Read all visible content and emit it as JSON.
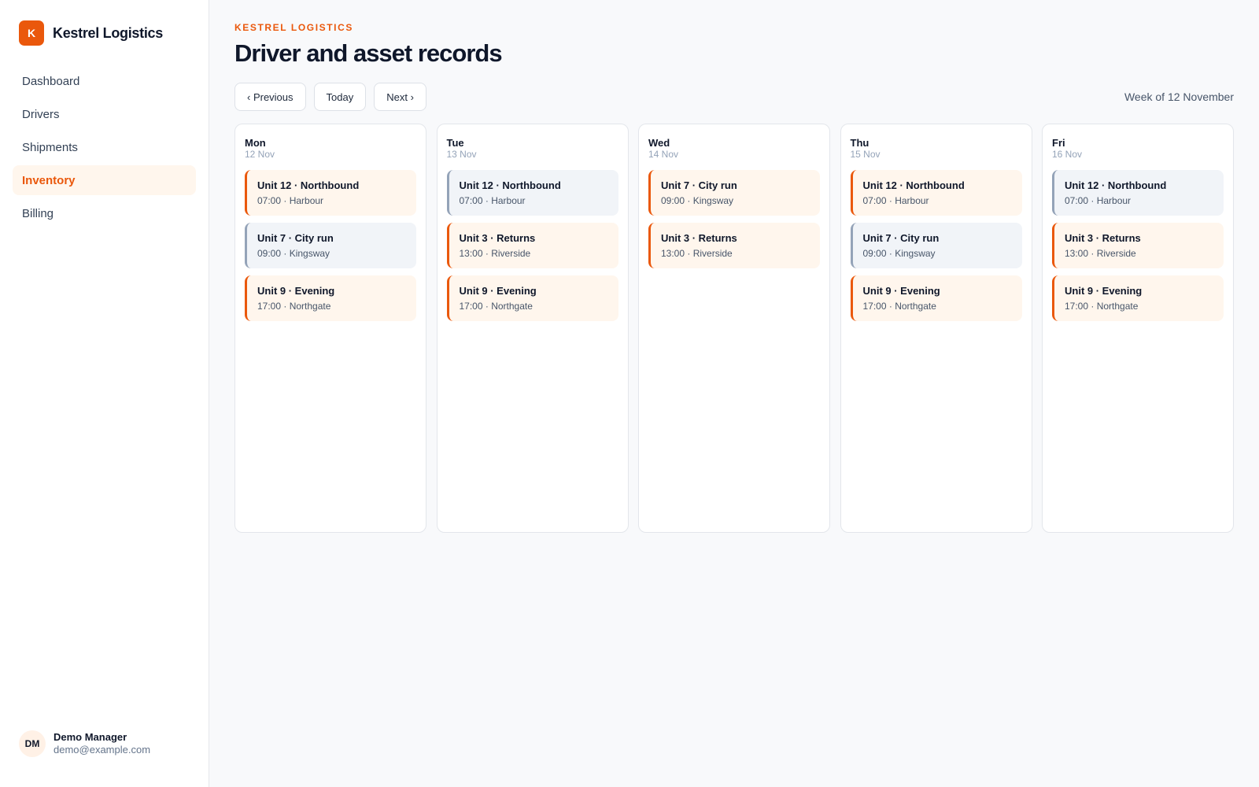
{
  "sidebar": {
    "brand_initial": "K",
    "brand_name": "Kestrel Logistics",
    "items": [
      {
        "label": "Dashboard",
        "active": false
      },
      {
        "label": "Drivers",
        "active": false
      },
      {
        "label": "Shipments",
        "active": false
      },
      {
        "label": "Inventory",
        "active": true
      },
      {
        "label": "Billing",
        "active": false
      }
    ],
    "user": {
      "initials": "DM",
      "name": "Demo Manager",
      "email": "demo@example.com"
    }
  },
  "header": {
    "eyebrow": "KESTREL LOGISTICS",
    "title": "Driver and asset records"
  },
  "toolbar": {
    "previous_label": "‹ Previous",
    "today_label": "Today",
    "next_label": "Next ›",
    "week_label": "Week of 12 November"
  },
  "colors": {
    "accent": "#ea580c",
    "accent_bg": "#fff6ed",
    "neutral_border": "#94a3b8",
    "neutral_bg": "#f1f4f8"
  },
  "days": [
    {
      "name": "Mon",
      "date": "12 Nov",
      "shifts": [
        {
          "title": "Unit 12 · Northbound",
          "detail": "07:00 · Harbour",
          "style": "accent"
        },
        {
          "title": "Unit 7 · City run",
          "detail": "09:00 · Kingsway",
          "style": "neutral"
        },
        {
          "title": "Unit 9 · Evening",
          "detail": "17:00 · Northgate",
          "style": "accent"
        }
      ]
    },
    {
      "name": "Tue",
      "date": "13 Nov",
      "shifts": [
        {
          "title": "Unit 12 · Northbound",
          "detail": "07:00 · Harbour",
          "style": "neutral"
        },
        {
          "title": "Unit 3 · Returns",
          "detail": "13:00 · Riverside",
          "style": "accent"
        },
        {
          "title": "Unit 9 · Evening",
          "detail": "17:00 · Northgate",
          "style": "accent"
        }
      ]
    },
    {
      "name": "Wed",
      "date": "14 Nov",
      "shifts": [
        {
          "title": "Unit 7 · City run",
          "detail": "09:00 · Kingsway",
          "style": "accent"
        },
        {
          "title": "Unit 3 · Returns",
          "detail": "13:00 · Riverside",
          "style": "accent"
        }
      ]
    },
    {
      "name": "Thu",
      "date": "15 Nov",
      "shifts": [
        {
          "title": "Unit 12 · Northbound",
          "detail": "07:00 · Harbour",
          "style": "accent"
        },
        {
          "title": "Unit 7 · City run",
          "detail": "09:00 · Kingsway",
          "style": "neutral"
        },
        {
          "title": "Unit 9 · Evening",
          "detail": "17:00 · Northgate",
          "style": "accent"
        }
      ]
    },
    {
      "name": "Fri",
      "date": "16 Nov",
      "shifts": [
        {
          "title": "Unit 12 · Northbound",
          "detail": "07:00 · Harbour",
          "style": "neutral"
        },
        {
          "title": "Unit 3 · Returns",
          "detail": "13:00 · Riverside",
          "style": "accent"
        },
        {
          "title": "Unit 9 · Evening",
          "detail": "17:00 · Northgate",
          "style": "accent"
        }
      ]
    }
  ]
}
